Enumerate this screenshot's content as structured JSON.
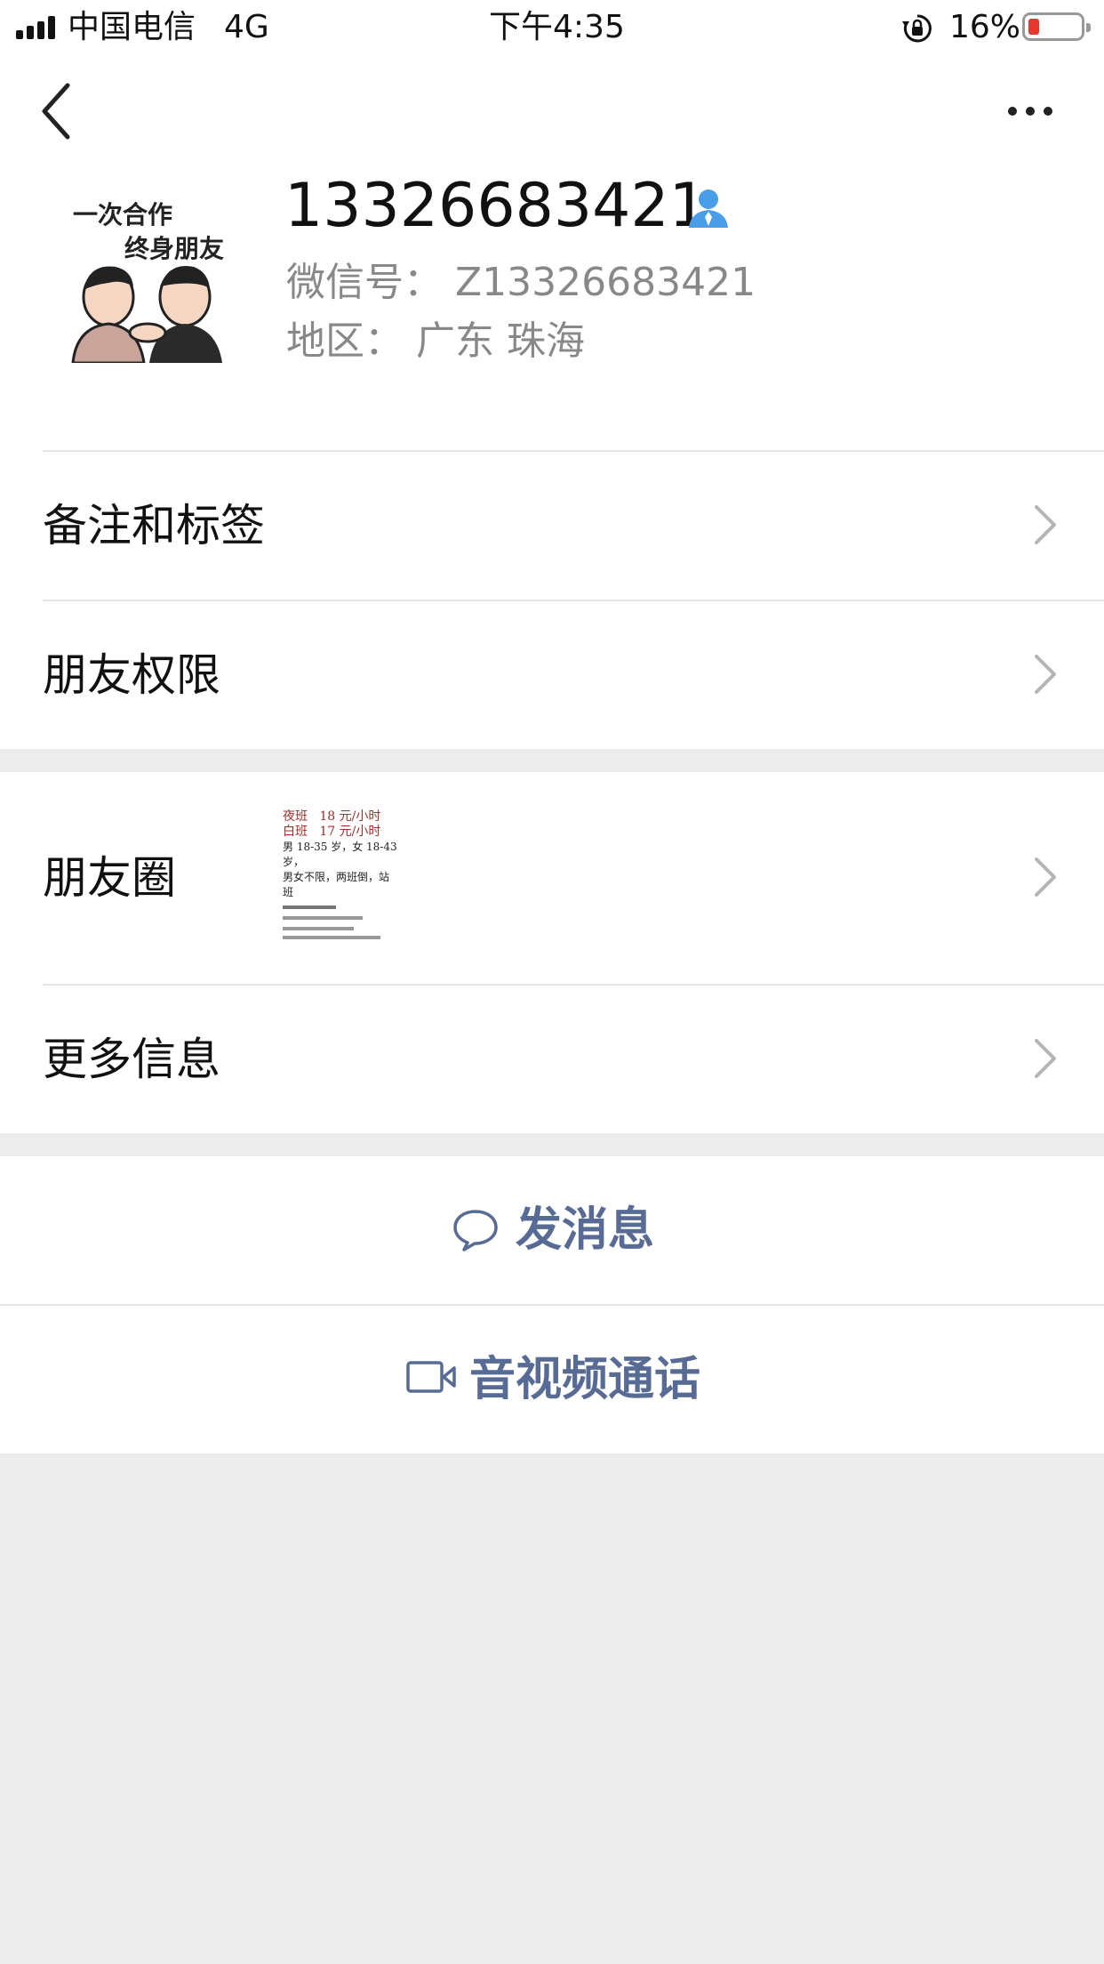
{
  "status_bar": {
    "carrier": "中国电信",
    "network": "4G",
    "time": "下午4:35",
    "battery_percent": "16%",
    "battery_level": 0.16,
    "battery_color": "#e5382e"
  },
  "nav": {
    "back_icon": "chevron-left-icon",
    "more_icon": "more-dots-icon"
  },
  "profile": {
    "avatar_text_line1": "一次合作",
    "avatar_text_line2": "终身朋友",
    "name": "13326683421",
    "contact_icon": "person-icon",
    "wechat_id_label": "微信号：",
    "wechat_id": "Z13326683421",
    "region_label": "地区：",
    "region": "广东 珠海"
  },
  "rows": [
    {
      "label": "备注和标签"
    },
    {
      "label": "朋友权限"
    },
    {
      "label": "朋友圈"
    },
    {
      "label": "更多信息"
    }
  ],
  "moments_thumb": {
    "line1_a": "夜班",
    "line1_b": "18 元/小时",
    "line2_a": "白班",
    "line2_b": "17 元/小时",
    "line3": "男 18-35 岁，女 18-43 岁，",
    "line4": "男女不限，两班倒，站班"
  },
  "actions": {
    "message_label": "发消息",
    "message_icon": "chat-bubble-icon",
    "call_label": "音视频通话",
    "call_icon": "video-camera-icon"
  },
  "colors": {
    "link_blue": "#576b95",
    "contact_icon_blue": "#4a9ee8",
    "background": "#ececec"
  }
}
